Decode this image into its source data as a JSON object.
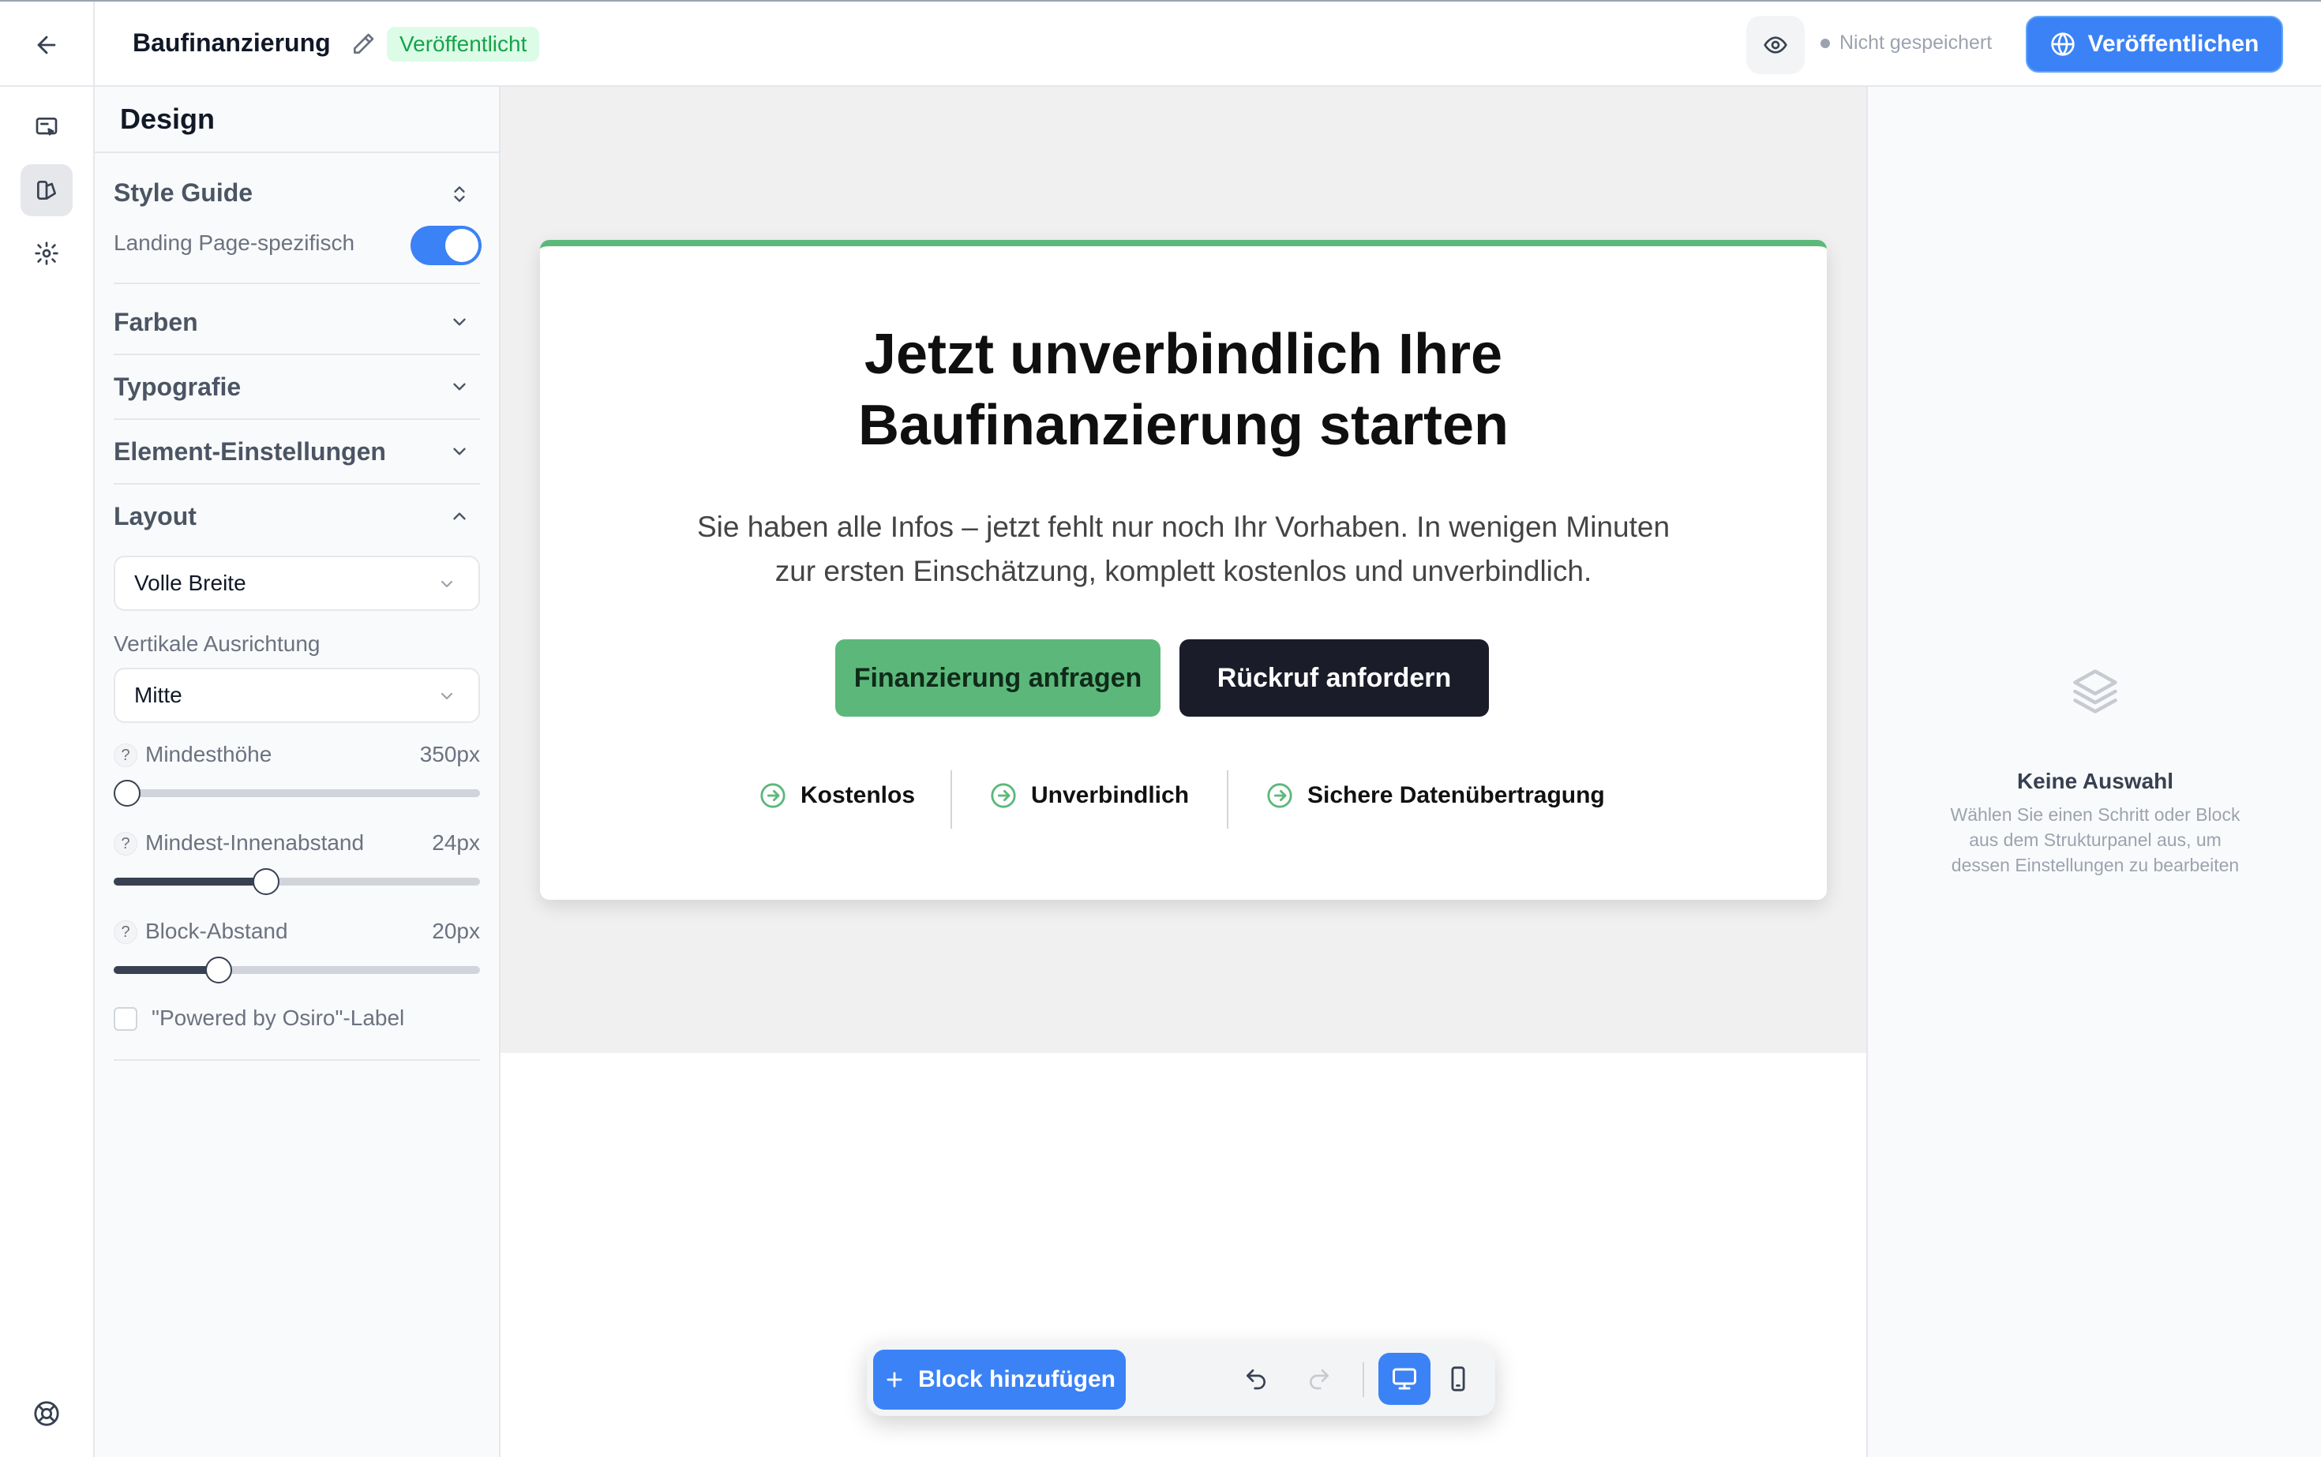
{
  "header": {
    "title": "Baufinanzierung",
    "status": "Veröffentlicht",
    "save_status": "Nicht gespeichert",
    "publish_label": "Veröffentlichen"
  },
  "design_panel": {
    "title": "Design",
    "style_guide": {
      "title": "Style Guide",
      "toggle_label": "Landing Page-spezifisch",
      "toggle_on": true
    },
    "sections": {
      "farben": "Farben",
      "typografie": "Typografie",
      "element_einstellungen": "Element-Einstellungen",
      "layout": "Layout"
    },
    "layout": {
      "width_value": "Volle Breite",
      "vertical_label": "Vertikale Ausrichtung",
      "vertical_value": "Mitte",
      "sliders": [
        {
          "name": "Mindesthöhe",
          "value": "350px",
          "fraction": 0.0
        },
        {
          "name": "Mindest-Innenabstand",
          "value": "24px",
          "fraction": 0.41
        },
        {
          "name": "Block-Abstand",
          "value": "20px",
          "fraction": 0.27
        }
      ],
      "powered_label": "\"Powered by Osiro\"-Label",
      "powered_checked": false
    }
  },
  "hero": {
    "title_line1": "Jetzt unverbindlich Ihre",
    "title_line2": "Baufinanzierung starten",
    "subtitle_line1": "Sie haben alle Infos – jetzt fehlt nur noch Ihr Vorhaben. In wenigen Minuten",
    "subtitle_line2": "zur ersten Einschätzung, komplett kostenlos und unverbindlich.",
    "primary_cta": "Finanzierung anfragen",
    "secondary_cta": "Rückruf anfordern",
    "features": [
      "Kostenlos",
      "Unverbindlich",
      "Sichere Datenübertragung"
    ],
    "accent_color": "#5cb87a"
  },
  "toolbar": {
    "add_block": "Block hinzufügen"
  },
  "right_panel": {
    "empty_title": "Keine Auswahl",
    "empty_desc": "Wählen Sie einen Schritt oder Block aus dem Strukturpanel aus, um dessen Einstellungen zu bearbeiten"
  },
  "icons": {
    "back": "arrow-left-icon",
    "edit": "pencil-icon",
    "preview": "eye-icon",
    "publish": "globe-icon",
    "rail": [
      "pages-icon",
      "design-icon",
      "gear-icon",
      "help-lifebuoy-icon"
    ],
    "right": "layers-icon"
  },
  "colors": {
    "brand_blue": "#3b82f6",
    "dark_button": "#1a1d29",
    "published_green": "#16a34a"
  }
}
